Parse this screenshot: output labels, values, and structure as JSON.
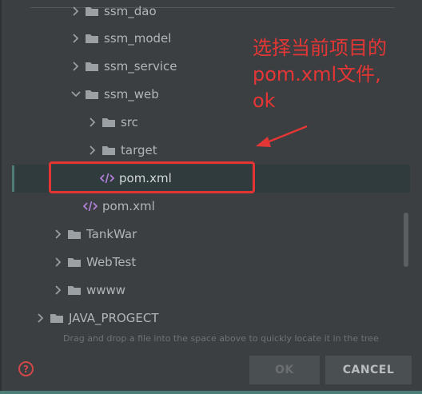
{
  "tree": {
    "items": [
      {
        "label": "ssm_dao",
        "type": "folder",
        "chevron": "right"
      },
      {
        "label": "ssm_model",
        "type": "folder",
        "chevron": "right"
      },
      {
        "label": "ssm_service",
        "type": "folder",
        "chevron": "right"
      },
      {
        "label": "ssm_web",
        "type": "folder",
        "chevron": "down"
      },
      {
        "label": "src",
        "type": "folder",
        "chevron": "right"
      },
      {
        "label": "target",
        "type": "folder",
        "chevron": "right"
      },
      {
        "label": "pom.xml",
        "type": "xml-file",
        "selected": true
      },
      {
        "label": "pom.xml",
        "type": "xml-file"
      },
      {
        "label": "TankWar",
        "type": "folder",
        "chevron": "right"
      },
      {
        "label": "WebTest",
        "type": "folder",
        "chevron": "right"
      },
      {
        "label": "wwww",
        "type": "folder",
        "chevron": "right"
      },
      {
        "label": "JAVA_PROGECT",
        "type": "folder",
        "chevron": "right"
      }
    ]
  },
  "hint": "Drag and drop a file into the space above to quickly locate it in the tree",
  "buttons": {
    "help": "?",
    "ok": "OK",
    "cancel": "CANCEL"
  },
  "annotation": {
    "line1": "选择当前项目的",
    "line2": "pom.xml文件,",
    "line3": "ok"
  },
  "colors": {
    "background": "#3c3f41",
    "selection": "#2f3b3d",
    "annotation": "#e53636",
    "accent": "#4c7d77"
  },
  "icons": {
    "folder": "folder-icon",
    "xml": "xml-file-icon",
    "chevron": "chevron-icon",
    "help": "help-icon"
  }
}
